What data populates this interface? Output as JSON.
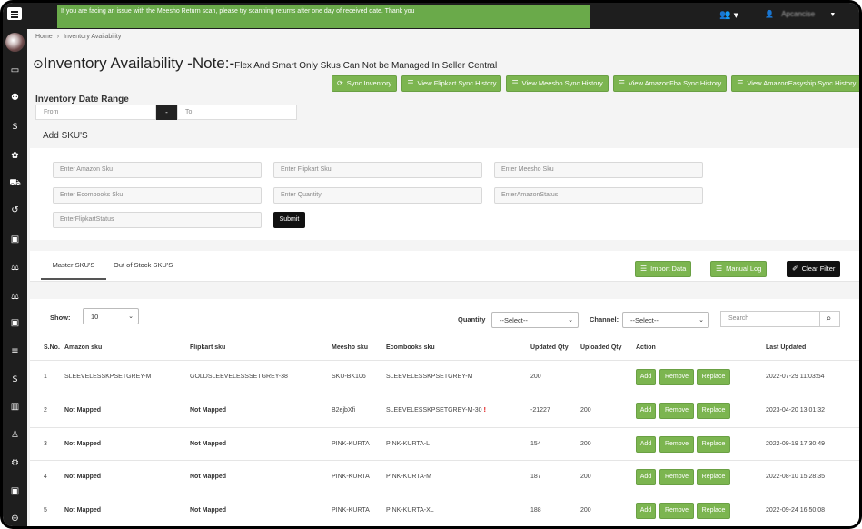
{
  "banner": "If you are facing an issue with the Meesho Return scan, please try scanning returns after one day of received date. Thank you",
  "topbar": {
    "user_name": "Apcancise"
  },
  "breadcrumb": {
    "home": "Home",
    "current": "Inventory Availability"
  },
  "title": {
    "main": "Inventory Availability -Note:-",
    "note": "Flex And Smart Only Skus Can Not be Managed In Seller Central"
  },
  "sync_buttons": [
    "Sync Inventory",
    "View Flipkart Sync History",
    "View Meesho Sync History",
    "View AmazonFba Sync History",
    "View AmazonEasyship Sync History"
  ],
  "date_range": {
    "label": "Inventory Date Range",
    "from_placeholder": "From",
    "separator": "-",
    "to_placeholder": "To"
  },
  "add_sku": {
    "title": "Add SKU'S",
    "fields": [
      "Enter Amazon Sku",
      "Enter Flipkart Sku",
      "Enter Meesho Sku",
      "Enter Ecombooks Sku",
      "Enter Quantity",
      "EnterAmazonStatus",
      "EnterFlipkartStatus"
    ],
    "submit": "Submit"
  },
  "tabs": {
    "master": "Master SKU'S",
    "out_of_stock": "Out of Stock SKU'S"
  },
  "actions": {
    "import": "Import Data",
    "manual_log": "Manual Log",
    "clear_filter": "Clear Filter"
  },
  "filters": {
    "show_label": "Show:",
    "show_value": "10",
    "quantity_label": "Quantity",
    "quantity_value": "--Select--",
    "channel_label": "Channel:",
    "channel_value": "--Select--",
    "search_placeholder": "Search"
  },
  "table": {
    "headers": [
      "S.No.",
      "Amazon sku",
      "Flipkart sku",
      "Meesho sku",
      "Ecombooks sku",
      "Updated Qty",
      "Uploaded Qty",
      "Action",
      "Last Updated"
    ],
    "row_buttons": {
      "add": "Add",
      "remove": "Remove",
      "replace": "Replace"
    },
    "rows": [
      {
        "sno": "1",
        "amazon": "SLEEVELESSKPSETGREY-M",
        "flipkart": "GOLDSLEEVELESSSETGREY-38",
        "meesho": "SKU-BK106",
        "ecombooks": "SLEEVELESSKPSETGREY-M",
        "warn": "",
        "updated": "200",
        "uploaded": "",
        "last": "2022-07-29 11:03:54"
      },
      {
        "sno": "2",
        "amazon": "Not Mapped",
        "flipkart": "Not Mapped",
        "meesho": "B2ejbXfi",
        "ecombooks": "SLEEVELESSKPSETGREY-M-30",
        "warn": "!",
        "updated": "-21227",
        "uploaded": "200",
        "last": "2023-04-20 13:01:32"
      },
      {
        "sno": "3",
        "amazon": "Not Mapped",
        "flipkart": "Not Mapped",
        "meesho": "PINK-KURTA",
        "ecombooks": "PINK-KURTA-L",
        "warn": "",
        "updated": "154",
        "uploaded": "200",
        "last": "2022-09-19 17:30:49"
      },
      {
        "sno": "4",
        "amazon": "Not Mapped",
        "flipkart": "Not Mapped",
        "meesho": "PINK-KURTA",
        "ecombooks": "PINK-KURTA-M",
        "warn": "",
        "updated": "187",
        "uploaded": "200",
        "last": "2022-08-10 15:28:35"
      },
      {
        "sno": "5",
        "amazon": "Not Mapped",
        "flipkart": "Not Mapped",
        "meesho": "PINK-KURTA",
        "ecombooks": "PINK-KURTA-XL",
        "warn": "",
        "updated": "188",
        "uploaded": "200",
        "last": "2022-09-24 16:50:08"
      }
    ]
  },
  "colors": {
    "green": "#7cb550",
    "dark": "#1e1e1e",
    "banner": "#6aaa4a"
  }
}
